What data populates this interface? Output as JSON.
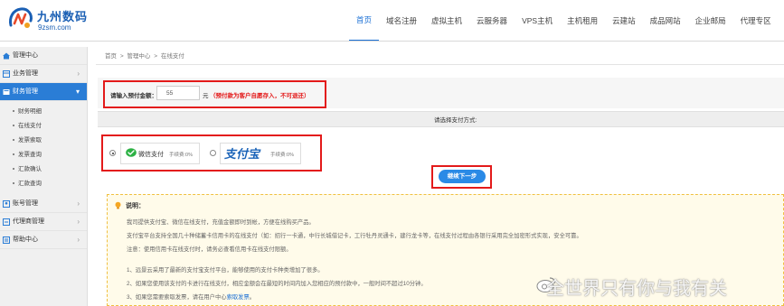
{
  "header": {
    "logo_title": "九州数码",
    "logo_domain": "9zsm.com",
    "nav": [
      "首页",
      "域名注册",
      "虚拟主机",
      "云服务器",
      "VPS主机",
      "主机租用",
      "云建站",
      "成品网站",
      "企业邮局",
      "代理专区"
    ],
    "nav_active": "首页"
  },
  "sidebar": {
    "items": [
      {
        "label": "管理中心",
        "icon": "home-icon",
        "has_arrow": false
      },
      {
        "label": "业务管理",
        "icon": "grid-icon",
        "has_arrow": true
      },
      {
        "label": "财务管理",
        "icon": "finance-icon",
        "has_arrow": true,
        "active": true
      },
      {
        "label": "账号管理",
        "icon": "user-icon",
        "has_arrow": true
      },
      {
        "label": "代理商管理",
        "icon": "agent-icon",
        "has_arrow": true
      },
      {
        "label": "帮助中心",
        "icon": "help-icon",
        "has_arrow": true
      }
    ],
    "finance_subitems": [
      "财务明细",
      "在线支付",
      "发票索取",
      "发票查询",
      "汇款确认",
      "汇款查询"
    ]
  },
  "breadcrumb": [
    "首页",
    "管理中心",
    "在线支付"
  ],
  "breadcrumb_separator": ">",
  "amount": {
    "label": "请输入预付金额：",
    "value": "55",
    "unit": "元",
    "note": "（预付款为客户自愿存入，不可退还）"
  },
  "payment": {
    "title": "请选择支付方式:",
    "wechat": {
      "name": "微信支付",
      "fee": "手续费:0%",
      "selected": true
    },
    "alipay": {
      "name": "支付宝",
      "fee": "手续费:0%",
      "selected": false
    }
  },
  "next_button": "继续下一步",
  "notice": {
    "title": "说明：",
    "lines": [
      "我司提供支付宝、微信在线支付，充值金额即时到帐，方便在线购买产品。",
      "支付宝平台支持全国几十种储蓄卡信用卡的在线支付（如：招行一卡通，中行长城借记卡，工行牡丹灵通卡，建行龙卡等，在线支付过程由各银行采用完全加密形式实现，安全可靠。",
      "注意：使用信用卡在线支付时，请务必查看信用卡在线支付限额。",
      "1、远景云采用了最新的支付宝支付平台，能够使用的支付卡种类增加了很多。",
      "2、如果您使用该支付的卡进行在线支付，相应金额会在最短的时间内加入您相应的预付款中，一般时间不超过10分钟。"
    ],
    "line6_text": "3、如果您需要索取发票，请在用户中心",
    "line6_link": "索取发票",
    "line6_end": "。"
  },
  "watermark": "全世界只有你与我有关",
  "colors": {
    "accent": "#2a7dd6",
    "highlight_border": "#e31a1a",
    "wechat_green": "#2cb144",
    "alipay_blue": "#1a63b8"
  }
}
